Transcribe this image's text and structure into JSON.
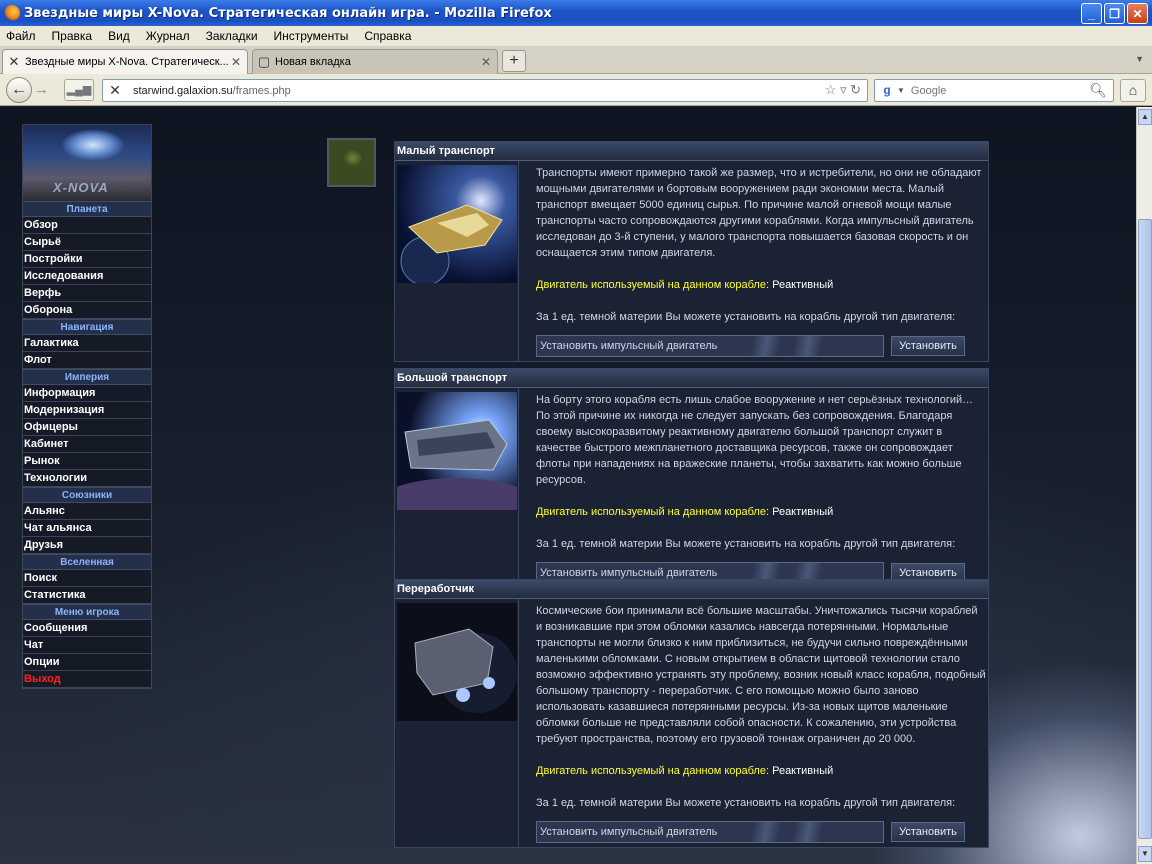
{
  "window": {
    "title": "Звездные миры X-Nova. Стратегическая онлайн игра. - Mozilla Firefox",
    "minimize": "_",
    "maximize": "❐",
    "close": "✕"
  },
  "menubar": [
    "Файл",
    "Правка",
    "Вид",
    "Журнал",
    "Закладки",
    "Инструменты",
    "Справка"
  ],
  "tabs": [
    {
      "label": "Звездные миры X-Nova. Стратегическ...",
      "close": "✕"
    },
    {
      "label": "Новая вкладка",
      "close": "✕"
    }
  ],
  "newtab": "+",
  "nav": {
    "back": "←",
    "forward": "→",
    "url_host": "starwind.galaxion.su",
    "url_path": "/frames.php",
    "url_right": "☆ ▿ ↻",
    "search_placeholder": "Google",
    "search_g": "g",
    "home": "⌂"
  },
  "leftmenu": {
    "logo_text": "X-NOVA",
    "groups": [
      {
        "section": "Планета",
        "items": [
          "Обзор",
          "Сырьё",
          "Постройки",
          "Исследования",
          "Верфь",
          "Оборона"
        ]
      },
      {
        "section": "Навигация",
        "items": [
          "Галактика",
          "Флот"
        ]
      },
      {
        "section": "Империя",
        "items": [
          "Информация",
          "Модернизация",
          "Офицеры",
          "Кабинет",
          "Рынок",
          "Технологии"
        ]
      },
      {
        "section": "Союзники",
        "items": [
          "Альянс",
          "Чат альянса",
          "Друзья"
        ]
      },
      {
        "section": "Вселенная",
        "items": [
          "Поиск",
          "Статистика"
        ]
      },
      {
        "section": "Меню игрока",
        "items": [
          "Сообщения",
          "Чат",
          "Опции"
        ]
      }
    ],
    "exit": "Выход"
  },
  "ships": [
    {
      "name": "Малый транспорт",
      "description": "Транспорты имеют примерно такой же размер, что и истребители, но они не обладают мощными двигателями и бортовым вооружением ради экономии места. Малый транспорт вмещает 5000 единиц сырья. По причине малой огневой мощи малые транспорты часто сопровождаются другими кораблями. Когда импульсный двигатель исследован до 3-й ступени, у малого транспорта повышается базовая скорость и он оснащается этим типом двигателя.",
      "engine_label": "Двигатель используемый на данном корабле:",
      "engine_value": "Реактивный",
      "dm_text": "За 1 ед. темной материи Вы можете установить на корабль другой тип двигателя:",
      "select_value": "Установить импульсный двигатель",
      "button": "Установить"
    },
    {
      "name": "Большой транспорт",
      "description": "На борту этого корабля есть лишь слабое вооружение и нет серьёзных технологий… По этой причине их никогда не следует запускать без сопровождения. Благодаря своему высокоразвитому реактивному двигателю большой транспорт служит в качестве быстрого межпланетного доставщика ресурсов, также он сопровождает флоты при нападениях на вражеские планеты, чтобы захватить как можно больше ресурсов.",
      "engine_label": "Двигатель используемый на данном корабле:",
      "engine_value": "Реактивный",
      "dm_text": "За 1 ед. темной материи Вы можете установить на корабль другой тип двигателя:",
      "select_value": "Установить импульсный двигатель",
      "button": "Установить"
    },
    {
      "name": "Переработчик",
      "description": "Космические бои принимали всё большие масштабы. Уничтожались тысячи кораблей и возникавшие при этом обломки казались навсегда потерянными. Нормальные транспорты не могли близко к ним приблизиться, не будучи сильно повреждёнными маленькими обломками. С новым открытием в области щитовой технологии стало возможно эффективно устранять эту проблему, возник новый класс корабля, подобный большому транспорту - переработчик. С его помощью можно было заново использовать казавшиеся потерянными ресурсы. Из-за новых щитов маленькие обломки больше не представляли собой опасности. К сожалению, эти устройства требуют пространства, поэтому его грузовой тоннаж ограничен до 20 000.",
      "engine_label": "Двигатель используемый на данном корабле:",
      "engine_value": "Реактивный",
      "dm_text": "За 1 ед. темной материи Вы можете установить на корабль другой тип двигателя:",
      "select_value": "Установить импульсный двигатель",
      "button": "Установить"
    }
  ]
}
